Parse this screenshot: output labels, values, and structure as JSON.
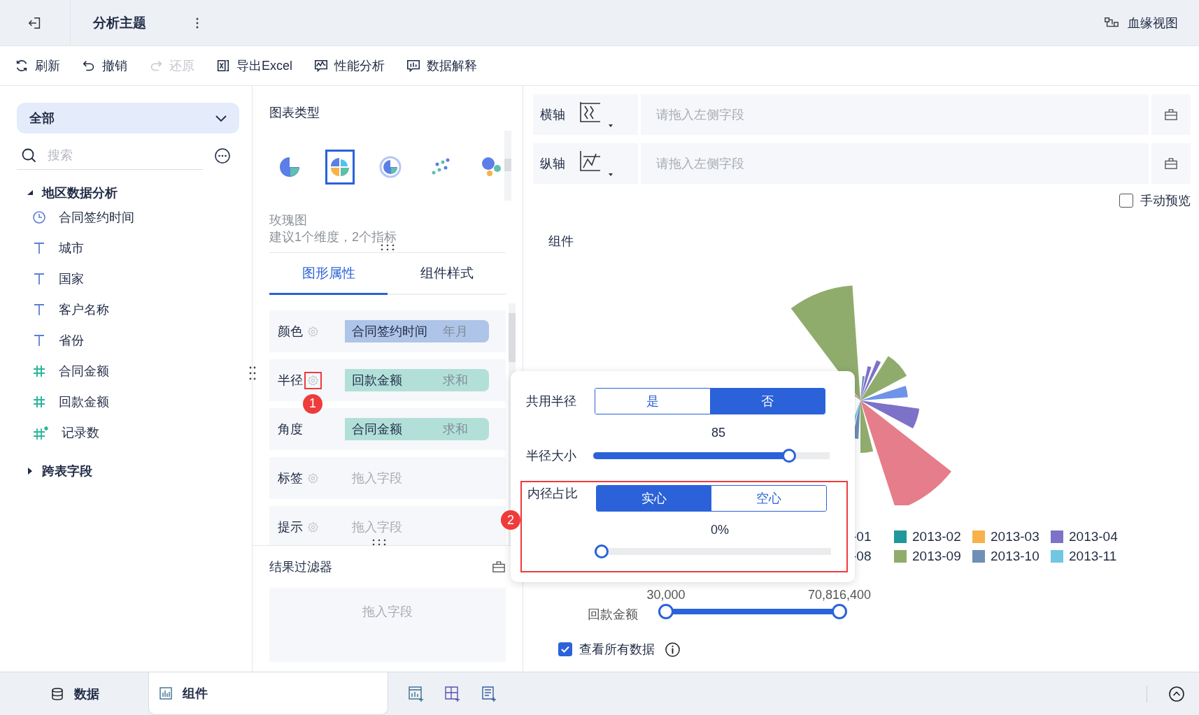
{
  "header": {
    "title": "分析主题",
    "lineage_link": "血缘视图"
  },
  "toolbar": [
    {
      "label": "刷新",
      "kind": "refresh",
      "disabled": false
    },
    {
      "label": "撤销",
      "kind": "undo",
      "disabled": false
    },
    {
      "label": "还原",
      "kind": "redo",
      "disabled": true
    },
    {
      "label": "导出Excel",
      "kind": "excel",
      "disabled": false
    },
    {
      "label": "性能分析",
      "kind": "performance",
      "disabled": false
    },
    {
      "label": "数据解释",
      "kind": "explain",
      "disabled": false
    }
  ],
  "fields_panel": {
    "dropdown": "全部",
    "search": {
      "placeholder": "搜索"
    },
    "tree": [
      {
        "label": "地区数据分析",
        "expanded": true,
        "children": [
          {
            "label": "合同签约时间",
            "kind": "date"
          },
          {
            "label": "城市",
            "kind": "text"
          },
          {
            "label": "国家",
            "kind": "text"
          },
          {
            "label": "客户名称",
            "kind": "text"
          },
          {
            "label": "省份",
            "kind": "text"
          },
          {
            "label": "合同金额",
            "kind": "number"
          },
          {
            "label": "回款金额",
            "kind": "number"
          },
          {
            "label": "记录数",
            "kind": "calculated"
          }
        ]
      },
      {
        "label": "跨表字段",
        "expanded": false
      }
    ]
  },
  "chart_type": {
    "title": "图表类型",
    "types": [
      {
        "kind": "pie",
        "selected": false
      },
      {
        "kind": "rose",
        "selected": true
      },
      {
        "kind": "donut",
        "selected": false
      },
      {
        "kind": "scatter",
        "selected": false
      },
      {
        "kind": "bubble",
        "selected": false
      }
    ],
    "name": "玫瑰图",
    "hint": "建议1个维度，2个指标"
  },
  "tabs": [
    {
      "label": "图形属性",
      "selected": true
    },
    {
      "label": "组件样式",
      "selected": false
    }
  ],
  "properties": [
    {
      "label": "颜色",
      "settings": true,
      "field": {
        "name": "合同签约时间",
        "aggregation": "年月",
        "kind": "dimension"
      }
    },
    {
      "label": "半径",
      "settings": true,
      "annotation": "1",
      "field": {
        "name": "回款金额",
        "aggregation": "求和",
        "kind": "measure"
      }
    },
    {
      "label": "角度",
      "settings": false,
      "field": {
        "name": "合同金额",
        "aggregation": "求和",
        "kind": "measure"
      }
    },
    {
      "label": "标签",
      "settings": true,
      "placeholder": "拖入字段"
    },
    {
      "label": "提示",
      "settings": true,
      "placeholder": "拖入字段"
    }
  ],
  "result_filter": {
    "title": "结果过滤器",
    "placeholder": "拖入字段"
  },
  "axes": [
    {
      "label": "横轴",
      "kind": "x",
      "placeholder": "请拖入左侧字段"
    },
    {
      "label": "纵轴",
      "kind": "y",
      "placeholder": "请拖入左侧字段"
    }
  ],
  "manual_preview": {
    "label": "手动预览",
    "checked": false
  },
  "component_title": "组件",
  "legend": [
    {
      "label": "-01"
    },
    {
      "label": "2013-02",
      "color": "#21979b"
    },
    {
      "label": "2013-03",
      "color": "#f7b24a"
    },
    {
      "label": "2013-04",
      "color": "#7c72c8"
    },
    {
      "label": "-08"
    },
    {
      "label": "2013-09",
      "color": "#8fac6d"
    },
    {
      "label": "2013-10",
      "color": "#6f8fb6"
    },
    {
      "label": "2013-11",
      "color": "#70c7e2"
    }
  ],
  "range_filter": {
    "label": "回款金额",
    "handles": [
      {
        "label": "30,000",
        "level": 0
      },
      {
        "label": "70,816,400",
        "level": 1
      }
    ]
  },
  "view_all": {
    "label": "查看所有数据",
    "checked": true
  },
  "popup": {
    "shared_radius": {
      "label": "共用半径",
      "options": [
        {
          "label": "是",
          "selected": false
        },
        {
          "label": "否",
          "selected": true
        }
      ]
    },
    "radius": {
      "label": "半径大小",
      "reading": "85",
      "level": 0.85
    },
    "inner_radius": {
      "label": "内径占比",
      "annotation": "2",
      "options": [
        {
          "label": "实心",
          "selected": true
        },
        {
          "label": "空心",
          "selected": false
        }
      ],
      "reading": "0%",
      "level": 0
    }
  },
  "bottom_tabs": [
    {
      "label": "数据",
      "kind": "data",
      "selected": false
    },
    {
      "label": "组件",
      "kind": "component",
      "selected": true
    }
  ]
}
